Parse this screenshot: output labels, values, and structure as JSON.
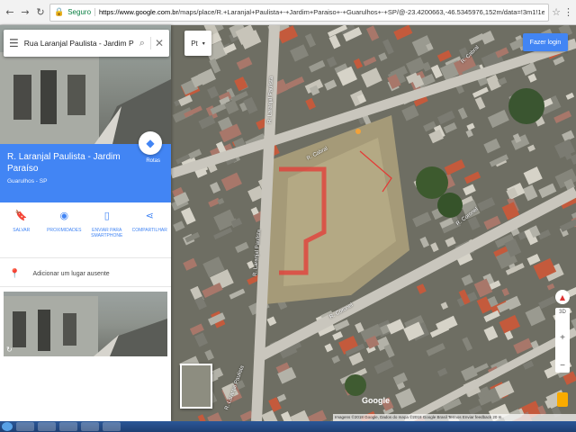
{
  "browser": {
    "secure_label": "Seguro",
    "url_host": "https://www.google.com.br",
    "url_rest": "/maps/place/R.+Laranjal+Paulista+-+Jardim+Paraiso+-+Guarulhos+-+SP/@-23.4200663,-46.5345976,152m/data=!3m1!1e3!4m5!3m4!1s0x94ce8a2"
  },
  "search": {
    "value": "Rua Laranjal Paulista - Jardim Pa"
  },
  "language": {
    "label": "Pt"
  },
  "signin": {
    "label": "Fazer login"
  },
  "place": {
    "title": "R. Laranjal Paulista - Jardim Paraíso",
    "subtitle": "Guarulhos - SP",
    "route_label": "Rotas"
  },
  "actions": [
    {
      "label": "SALVAR",
      "icon": "bookmark-icon"
    },
    {
      "label": "PROXIMIDADES",
      "icon": "nearby-icon"
    },
    {
      "label": "ENVIAR PARA SMARTPHONE",
      "icon": "send-to-phone-icon"
    },
    {
      "label": "COMPARTILHAR",
      "icon": "share-icon"
    }
  ],
  "add_place": {
    "label": "Adicionar um lugar ausente"
  },
  "map": {
    "streets": [
      "R. Cabral",
      "R. Cabral",
      "R. Laranjal Paulista",
      "R. Laranjal Paulista",
      "R. Coronel",
      "R. Laranjal Paulista",
      "R. Coronel"
    ],
    "google_logo": "Google",
    "attribution": "Imagens ©2018 Google, Dados do mapa ©2018 Google   Brasil   Termos   Enviar feedback   20 m",
    "zoom_in": "+",
    "zoom_out": "−",
    "zoom_3d": "3D"
  },
  "colors": {
    "accent": "#4285f4",
    "overlay_red": "#e53935"
  }
}
